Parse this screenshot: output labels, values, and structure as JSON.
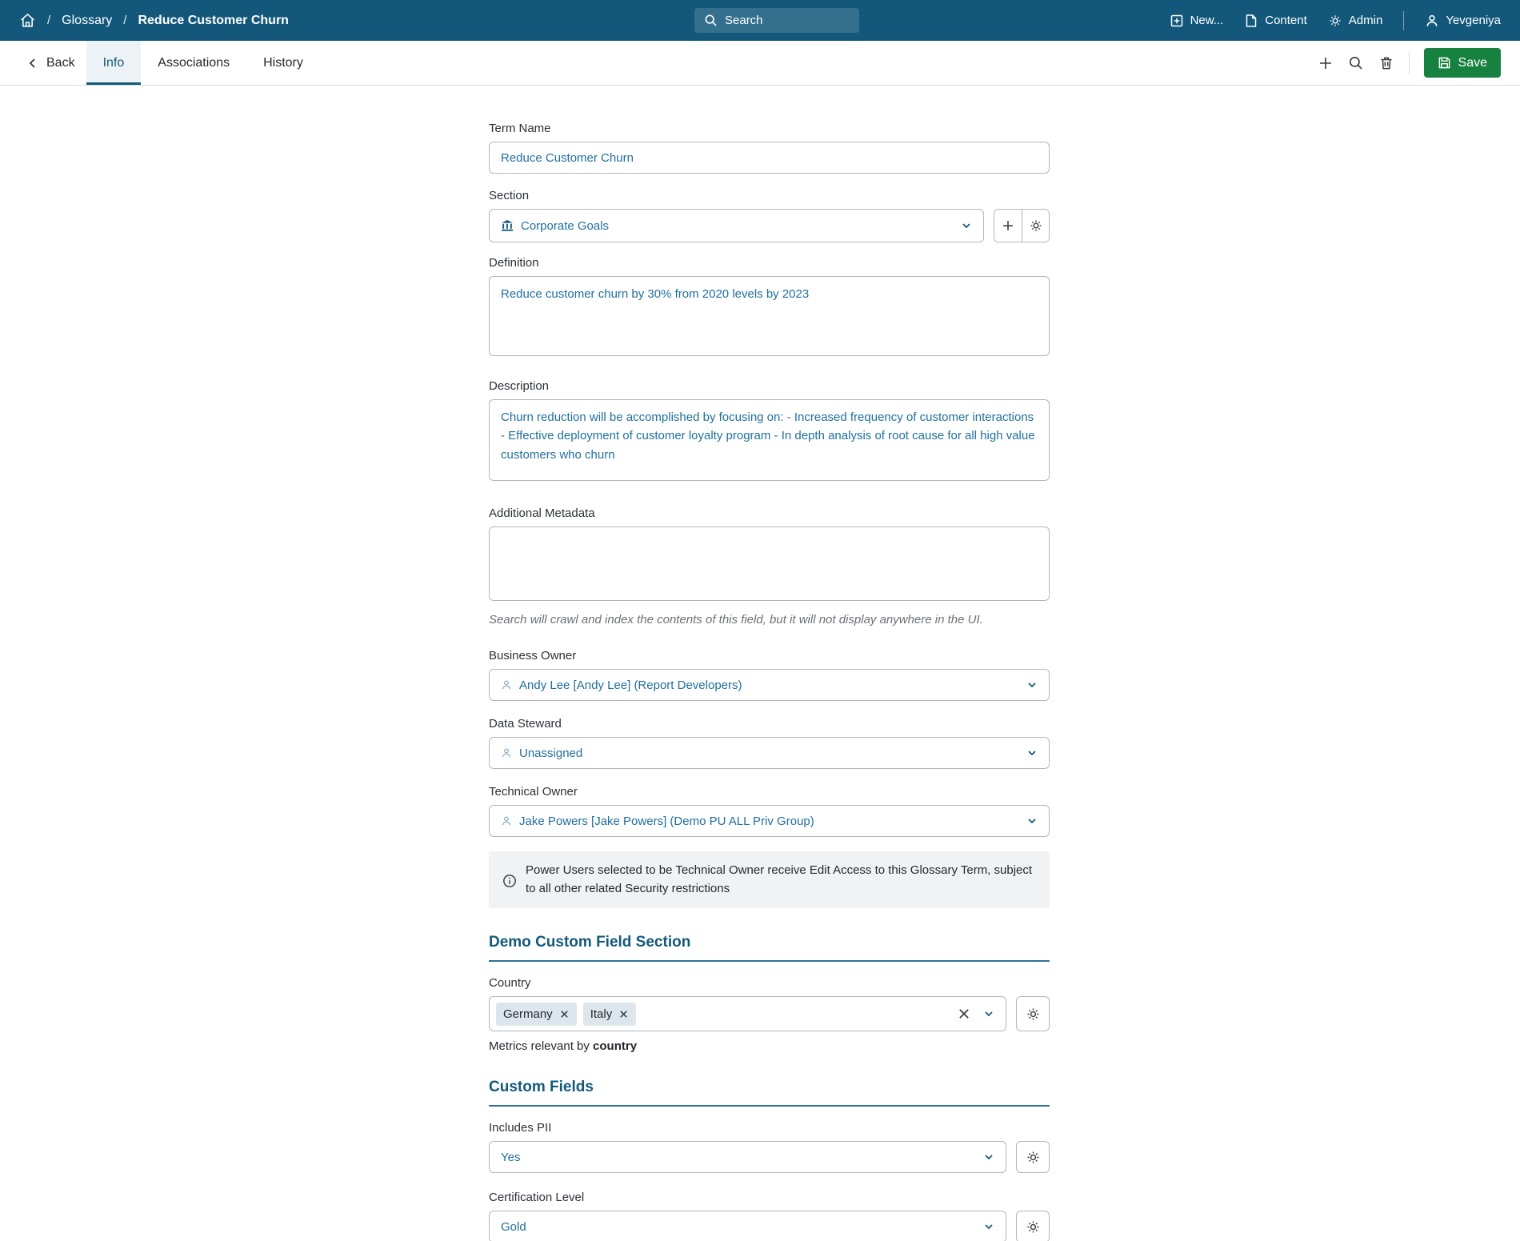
{
  "colors": {
    "navbar_bg": "#13587b",
    "accent_teal": "#14597c",
    "save_green": "#17823f",
    "value_text": "#1f6f9e",
    "active_tab_bg": "#edf2f7",
    "chip_bg": "#dde6ec",
    "info_box_bg": "#f1f2f3"
  },
  "navbar": {
    "breadcrumb": {
      "separator": "/",
      "glossary": "Glossary",
      "current": "Reduce Customer Churn"
    },
    "search_label": "Search",
    "new_label": "New...",
    "content_label": "Content",
    "admin_label": "Admin",
    "user_label": "Yevgeniya"
  },
  "toolbar": {
    "back_label": "Back",
    "tabs": [
      {
        "label": "Info"
      },
      {
        "label": "Associations"
      },
      {
        "label": "History"
      }
    ],
    "save_label": "Save"
  },
  "form": {
    "term_name": {
      "label": "Term Name",
      "value": "Reduce Customer Churn"
    },
    "section": {
      "label": "Section",
      "value": "Corporate Goals"
    },
    "definition": {
      "label": "Definition",
      "value": "Reduce customer churn by 30% from 2020 levels by 2023"
    },
    "description": {
      "label": "Description",
      "value": "Churn reduction will be accomplished by focusing on: - Increased frequency of customer interactions - Effective deployment of customer loyalty program - In depth analysis of root cause for all high value customers who churn"
    },
    "additional_metadata": {
      "label": "Additional Metadata",
      "value": "",
      "helper": "Search will crawl and index the contents of this field, but it will not display anywhere in the UI."
    },
    "business_owner": {
      "label": "Business Owner",
      "value": "Andy Lee [Andy Lee] (Report Developers)"
    },
    "data_steward": {
      "label": "Data Steward",
      "value": "Unassigned"
    },
    "technical_owner": {
      "label": "Technical Owner",
      "value": "Jake Powers [Jake Powers] (Demo PU ALL Priv Group)"
    },
    "technical_owner_note": "Power Users selected to be Technical Owner receive Edit Access to this Glossary Term, subject to all other related Security restrictions"
  },
  "demo_section": {
    "title": "Demo Custom Field Section",
    "country": {
      "label": "Country",
      "chips": [
        "Germany",
        "Italy"
      ],
      "help_prefix": "Metrics relevant by ",
      "help_bold": "country"
    }
  },
  "custom_fields_section": {
    "title": "Custom Fields",
    "includes_pii": {
      "label": "Includes PII",
      "value": "Yes"
    },
    "certification_level": {
      "label": "Certification Level",
      "value": "Gold"
    }
  }
}
